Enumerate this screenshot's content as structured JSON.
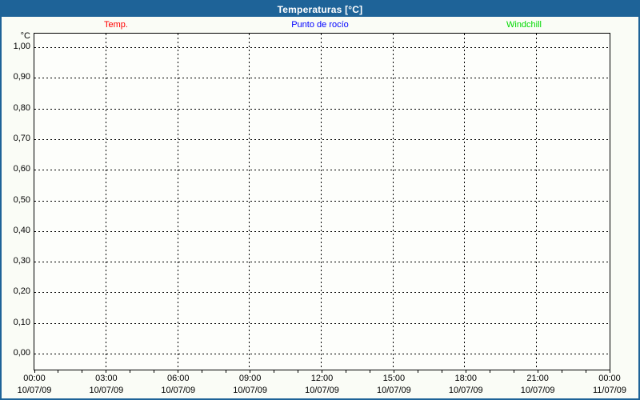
{
  "window": {
    "title": "Temperaturas [°C]"
  },
  "colors": {
    "accent": "#1e6398",
    "titlebar_text": "#ffffff",
    "grid": "#000000",
    "background": "#fafcf6",
    "plot_background": "#fdfefb",
    "series_temp": "#ff0000",
    "series_dewpoint": "#0000ff",
    "series_windchill": "#00d900"
  },
  "legend": {
    "items": [
      {
        "label": "Temp.",
        "color": "#ff0000"
      },
      {
        "label": "Punto de rocío",
        "color": "#0000ff"
      },
      {
        "label": "Windchill",
        "color": "#00d900"
      }
    ]
  },
  "chart_data": {
    "type": "line",
    "title": "Temperaturas [°C]",
    "ylabel": "°C",
    "xlabel": "",
    "ylim": [
      0.0,
      1.0
    ],
    "y_tick_step": 0.1,
    "y_tick_labels": [
      "1,00",
      "0,90",
      "0,80",
      "0,70",
      "0,60",
      "0,50",
      "0,40",
      "0,30",
      "0,20",
      "0,10",
      "0,00"
    ],
    "x_ticks": [
      {
        "time": "00:00",
        "date": "10/07/09"
      },
      {
        "time": "03:00",
        "date": "10/07/09"
      },
      {
        "time": "06:00",
        "date": "10/07/09"
      },
      {
        "time": "09:00",
        "date": "10/07/09"
      },
      {
        "time": "12:00",
        "date": "10/07/09"
      },
      {
        "time": "15:00",
        "date": "10/07/09"
      },
      {
        "time": "18:00",
        "date": "10/07/09"
      },
      {
        "time": "21:00",
        "date": "10/07/09"
      },
      {
        "time": "00:00",
        "date": "11/07/09"
      }
    ],
    "x_minor_tick_interval_hours": 1,
    "x_major_interval_hours": 3,
    "grid": "dashed black, horizontal every 0.10, vertical every 3 hours",
    "legend_position": "top",
    "series": [
      {
        "name": "Temp.",
        "color": "#ff0000",
        "values": []
      },
      {
        "name": "Punto de rocío",
        "color": "#0000ff",
        "values": []
      },
      {
        "name": "Windchill",
        "color": "#00d900",
        "values": []
      }
    ]
  }
}
